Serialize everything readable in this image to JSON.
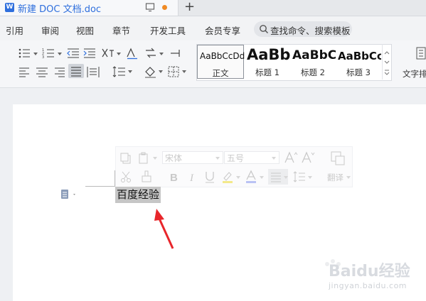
{
  "titlebar": {
    "document_tab_title": "新建 DOC 文档.doc",
    "app_icon_letter": "W",
    "add_tab_symbol": "+"
  },
  "menubar": {
    "items": [
      "引用",
      "审阅",
      "视图",
      "章节",
      "开发工具",
      "会员专享"
    ],
    "search_label": "查找命令、搜索模板"
  },
  "style_gallery": {
    "items": [
      {
        "preview": "AaBbCcDd",
        "name": "正文"
      },
      {
        "preview": "AaBb",
        "name": "标题 1"
      },
      {
        "preview": "AaBbC",
        "name": "标题 2"
      },
      {
        "preview": "AaBbCc",
        "name": "标题 3"
      }
    ],
    "selected_index": 0
  },
  "text_layout_label": "文字排",
  "floating_toolbar": {
    "font_name": "宋体",
    "font_size": "五号",
    "translate_label": "翻译"
  },
  "document": {
    "selected_text": "百度经验"
  },
  "watermark": {
    "brand": "Baidu经验",
    "url": "jingyan.baidu.com"
  },
  "colors": {
    "accent_blue": "#2f6fdd",
    "unsaved_dot": "#f08a24",
    "arrow_red": "#e8262b",
    "selection_gray": "#c6c6c6"
  }
}
